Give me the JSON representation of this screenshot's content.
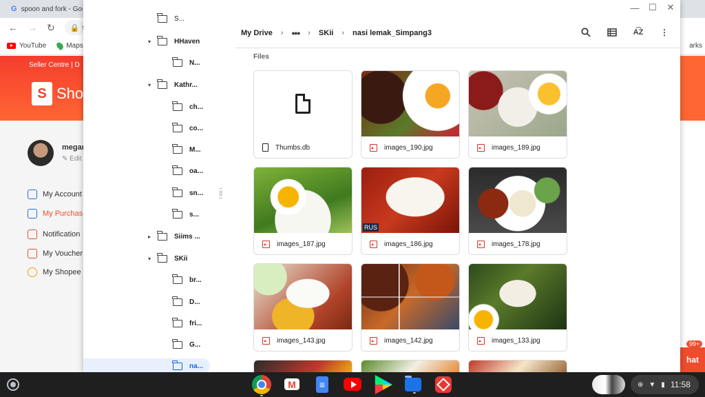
{
  "browser": {
    "tab_title": "spoon and fork - Goo",
    "omnibox_text": "sh",
    "bookmarks": [
      "YouTube",
      "Maps"
    ],
    "bookmarks_overflow": "arks"
  },
  "shopee": {
    "seller_centre": "Seller Centre",
    "seller_centre_sep": "D",
    "logo_text": "Sho",
    "user_name": "megar",
    "edit_label": "Edit",
    "menu": [
      "My Account",
      "My Purchas",
      "Notification",
      "My Voucher",
      "My Shopee"
    ],
    "chat_label": "hat",
    "chat_badge": "99+"
  },
  "window_controls": {
    "minimize": "—",
    "maximize": "☐",
    "close": "✕"
  },
  "nav_tree": {
    "rows": [
      {
        "label": "S...",
        "arrow": ""
      },
      {
        "label": "HHaven",
        "arrow": "▾"
      },
      {
        "label": "N...",
        "arrow": ""
      },
      {
        "label": "Kathr...",
        "arrow": "▾"
      },
      {
        "label": "ch...",
        "arrow": ""
      },
      {
        "label": "co...",
        "arrow": ""
      },
      {
        "label": "M...",
        "arrow": ""
      },
      {
        "label": "oa...",
        "arrow": ""
      },
      {
        "label": "sn...",
        "arrow": ""
      },
      {
        "label": "s...",
        "arrow": ""
      },
      {
        "label": "Siims ...",
        "arrow": "▸"
      },
      {
        "label": "SKii",
        "arrow": "▾"
      },
      {
        "label": "br...",
        "arrow": ""
      },
      {
        "label": "D...",
        "arrow": ""
      },
      {
        "label": "fri...",
        "arrow": ""
      },
      {
        "label": "G...",
        "arrow": ""
      },
      {
        "label": "na...",
        "arrow": ""
      }
    ]
  },
  "breadcrumb": {
    "root": "My Drive",
    "more": "•••",
    "parent": "SKii",
    "current": "nasi lemak_Simpang3"
  },
  "actions": [
    "search-icon",
    "grid-view-icon",
    "sort-icon",
    "more-vert-icon"
  ],
  "section_label": "Files",
  "files": [
    {
      "name": "Thumbs.db",
      "kind": "doc"
    },
    {
      "name": "images_190.jpg",
      "kind": "image"
    },
    {
      "name": "images_189.jpg",
      "kind": "image"
    },
    {
      "name": "images_187.jpg",
      "kind": "image"
    },
    {
      "name": "images_186.jpg",
      "kind": "image"
    },
    {
      "name": "images_178.jpg",
      "kind": "image"
    },
    {
      "name": "images_143.jpg",
      "kind": "image"
    },
    {
      "name": "images_142.jpg",
      "kind": "image"
    },
    {
      "name": "images_133.jpg",
      "kind": "image"
    }
  ],
  "thumb_overlay_186": "RUS",
  "shelf": {
    "apps": [
      "Chrome",
      "Gmail",
      "Docs",
      "YouTube",
      "Play Store",
      "Files",
      "Photos"
    ],
    "time": "11:58"
  }
}
